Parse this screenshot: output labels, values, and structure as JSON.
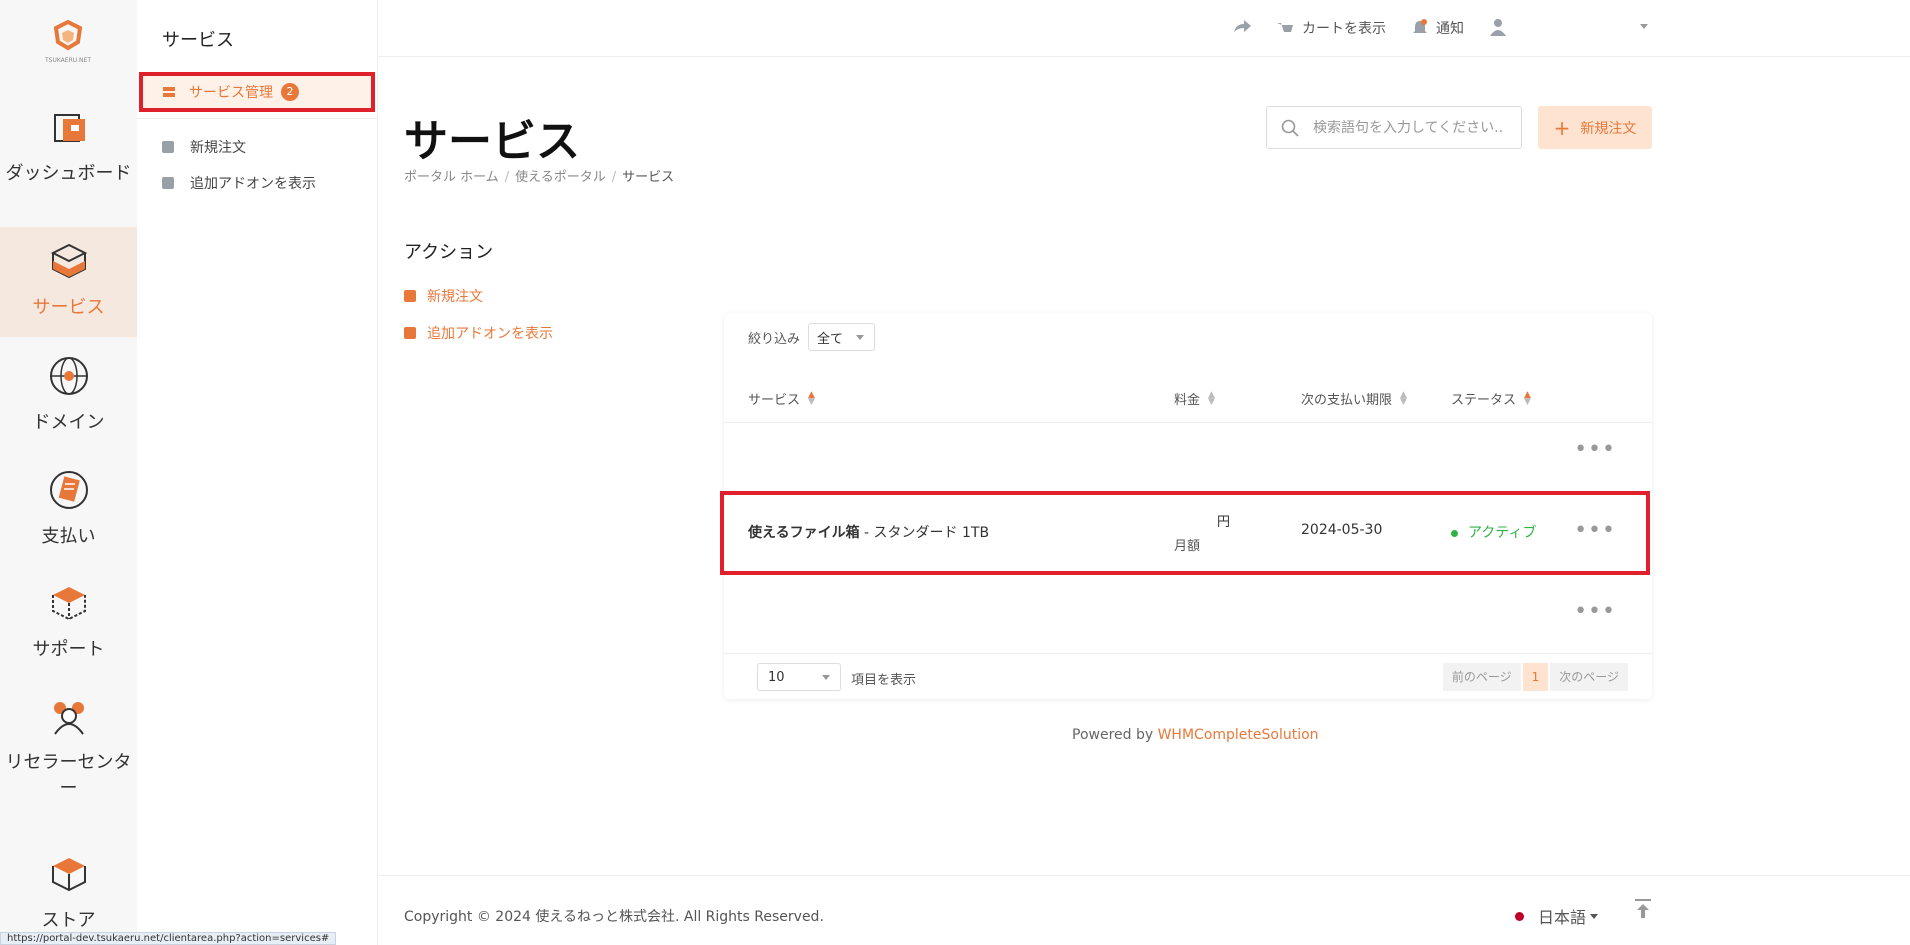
{
  "rail": {
    "logo_text": "TSUKAERU.NET",
    "items": [
      {
        "label": "ダッシュボード",
        "icon": "dashboard-icon"
      },
      {
        "label": "サービス",
        "icon": "services-icon",
        "active": true
      },
      {
        "label": "ドメイン",
        "icon": "globe-icon"
      },
      {
        "label": "支払い",
        "icon": "billing-icon"
      },
      {
        "label": "サポート",
        "icon": "support-icon"
      },
      {
        "label": "リセラーセンター",
        "icon": "reseller-icon"
      },
      {
        "label": "ストア",
        "icon": "store-icon"
      }
    ]
  },
  "subnav": {
    "title": "サービス",
    "items": [
      {
        "label": "サービス管理",
        "badge": "2",
        "active": true
      },
      {
        "label": "新規注文"
      },
      {
        "label": "追加アドオンを表示"
      }
    ]
  },
  "topbar": {
    "cart_label": "カートを表示",
    "notify_label": "通知"
  },
  "main": {
    "title": "サービス",
    "breadcrumb": [
      "ポータル ホーム",
      "使えるポータル",
      "サービス"
    ],
    "search_placeholder": "検索語句を入力してください...",
    "new_order_label": "新規注文",
    "actions_title": "アクション",
    "actions": [
      "新規注文",
      "追加アドオンを表示"
    ]
  },
  "table": {
    "filter_label": "絞り込み",
    "filter_value": "全て",
    "columns": [
      "サービス",
      "料金",
      "次の支払い期限",
      "ステータス"
    ],
    "row": {
      "product": "使えるファイル箱",
      "plan": " - スタンダード 1TB",
      "price_unit": "円",
      "cycle": "月額",
      "due_date": "2024-05-30",
      "status": "アクティブ"
    },
    "perpage": "10",
    "perpage_label": "項目を表示",
    "prev_label": "前のページ",
    "page": "1",
    "next_label": "次のページ"
  },
  "powered": {
    "prefix": "Powered by ",
    "brand": "WHMCompleteSolution"
  },
  "footer": {
    "copyright": "Copyright © 2024 使えるねっと株式会社. All Rights Reserved.",
    "language": "日本語"
  },
  "statusbar": "https://portal-dev.tsukaeru.net/clientarea.php?action=services#",
  "colors": {
    "accent": "#e8783a",
    "highlight": "#e0202a",
    "active_status": "#2fb344"
  }
}
